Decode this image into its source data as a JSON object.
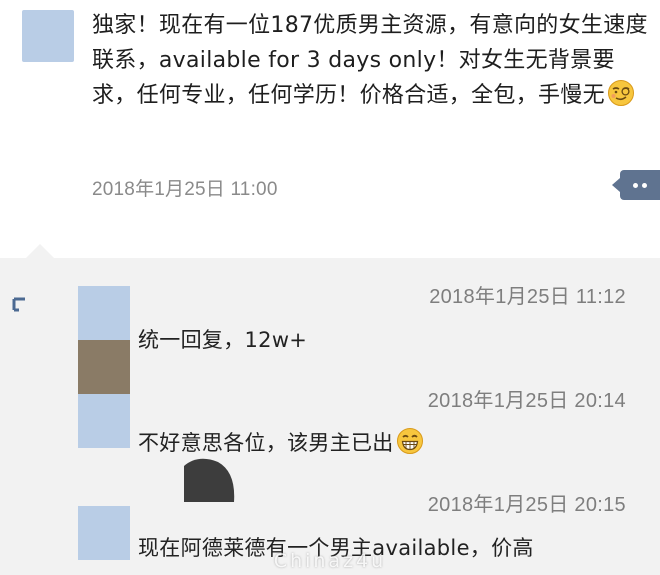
{
  "post": {
    "text": "独家！现在有一位187优质男主资源，有意向的女生速度联系，available for 3 days only！对女生无背景要求，任何专业，任何学历！价格合适，全包，手慢无",
    "emoji": "smug-face-icon",
    "time": "2018年1月25日 11:00"
  },
  "comments": [
    {
      "time": "2018年1月25日 11:12",
      "text": "统一回复，12w+",
      "avatar_color": "#b9cde6"
    },
    {
      "time": "2018年1月25日 20:14",
      "text": "不好意思各位，该男主已出",
      "avatar_color": "#8a7b66",
      "emoji": "grinning-face-icon"
    },
    {
      "time": "2018年1月25日 20:15",
      "text": "现在阿德莱德有一个男主available，价高",
      "avatar_color": "#b9cde6"
    }
  ],
  "watermark": "Chinaz4u",
  "colors": {
    "avatar_blue": "#b9cde6",
    "more_button": "#5f7390",
    "timestamp": "#8a8a8a",
    "comment_bg": "#f2f2f2"
  }
}
